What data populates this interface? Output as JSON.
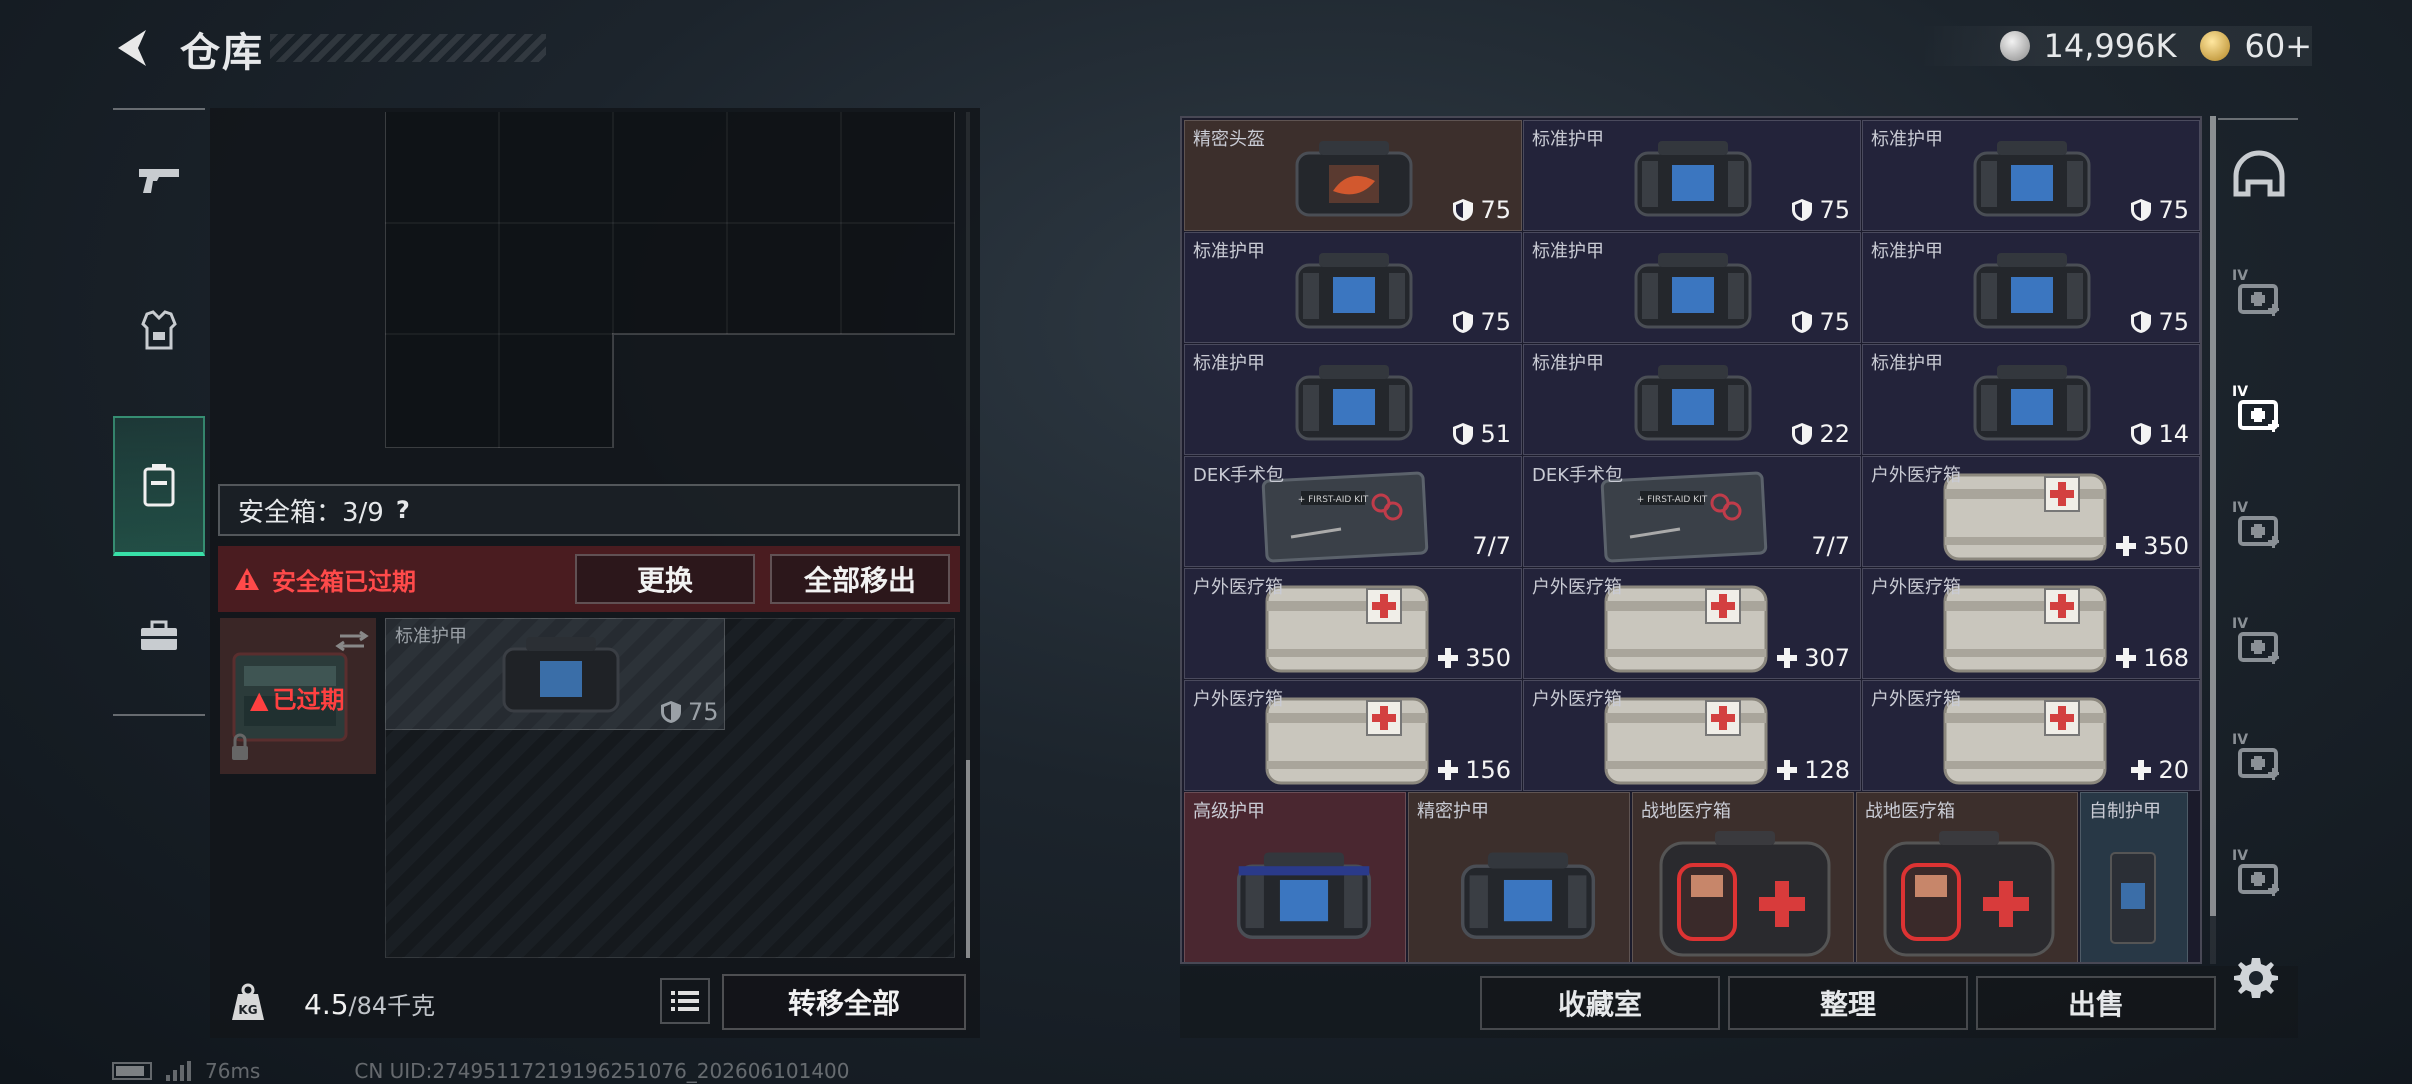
{
  "header": {
    "title": "仓库"
  },
  "currency": {
    "silver": "14,996K",
    "gold": "60+"
  },
  "side_nav": [
    {
      "icon": "pistol-icon"
    },
    {
      "icon": "vest-icon"
    },
    {
      "icon": "safe-case-icon",
      "active": true
    },
    {
      "icon": "toolbox-icon"
    }
  ],
  "safe_case": {
    "label": "安全箱：3/9",
    "help": "?",
    "warning": "安全箱已过期",
    "replace_label": "更换",
    "move_out_label": "全部移出",
    "expired_badge": "已过期",
    "item": {
      "name": "标准护甲",
      "value": "75"
    }
  },
  "weight": {
    "current": "4.5",
    "max_text": "/84千克",
    "unit_icon": "KG"
  },
  "transfer_all_label": "转移全部",
  "stash_items": [
    {
      "name": "精密头盔",
      "value": "75",
      "kind": "shield",
      "bg": "brown",
      "art": "helmet"
    },
    {
      "name": "标准护甲",
      "value": "75",
      "kind": "shield",
      "art": "armor"
    },
    {
      "name": "标准护甲",
      "value": "75",
      "kind": "shield",
      "art": "armor"
    },
    {
      "name": "标准护甲",
      "value": "75",
      "kind": "shield",
      "art": "armor"
    },
    {
      "name": "标准护甲",
      "value": "75",
      "kind": "shield",
      "art": "armor"
    },
    {
      "name": "标准护甲",
      "value": "75",
      "kind": "shield",
      "art": "armor"
    },
    {
      "name": "标准护甲",
      "value": "51",
      "kind": "shield",
      "art": "armor"
    },
    {
      "name": "标准护甲",
      "value": "22",
      "kind": "shield",
      "art": "armor"
    },
    {
      "name": "标准护甲",
      "value": "14",
      "kind": "shield",
      "art": "armor"
    },
    {
      "name": "DEK手术包",
      "value": "7/7",
      "kind": "plain",
      "art": "surgery"
    },
    {
      "name": "DEK手术包",
      "value": "7/7",
      "kind": "plain",
      "art": "surgery"
    },
    {
      "name": "户外医疗箱",
      "value": "350",
      "kind": "plus",
      "art": "medkit"
    },
    {
      "name": "户外医疗箱",
      "value": "350",
      "kind": "plus",
      "art": "medkit"
    },
    {
      "name": "户外医疗箱",
      "value": "307",
      "kind": "plus",
      "art": "medkit"
    },
    {
      "name": "户外医疗箱",
      "value": "168",
      "kind": "plus",
      "art": "medkit"
    },
    {
      "name": "户外医疗箱",
      "value": "156",
      "kind": "plus",
      "art": "medkit"
    },
    {
      "name": "户外医疗箱",
      "value": "128",
      "kind": "plus",
      "art": "medkit"
    },
    {
      "name": "户外医疗箱",
      "value": "20",
      "kind": "plus",
      "art": "medkit"
    }
  ],
  "stash_bottom_items": [
    {
      "name": "高级护甲",
      "bg": "red",
      "art": "armor-adv"
    },
    {
      "name": "精密护甲",
      "bg": "brown",
      "art": "armor"
    },
    {
      "name": "战地医疗箱",
      "bg": "brown",
      "art": "firstaid"
    },
    {
      "name": "战地医疗箱",
      "bg": "brown",
      "art": "firstaid"
    },
    {
      "name": "自制护甲",
      "bg": "blue",
      "art": "homemade"
    }
  ],
  "categories": [
    {
      "icon": "helmet-category-icon"
    },
    {
      "icon": "stash-tab-iv-1-icon",
      "label": "IV"
    },
    {
      "icon": "stash-tab-iv-2-icon",
      "label": "IV"
    },
    {
      "icon": "stash-tab-iv-3-icon",
      "label": "IV"
    },
    {
      "icon": "stash-tab-iv-4-icon",
      "label": "IV"
    },
    {
      "icon": "stash-tab-iv-5-icon",
      "label": "IV"
    },
    {
      "icon": "stash-tab-iv-6-icon",
      "label": "IV"
    }
  ],
  "bottom_buttons": {
    "collection": "收藏室",
    "sort": "整理",
    "sell": "出售"
  },
  "footer": {
    "ping": "76ms",
    "uid": "CN UID:2749511721919625107​6_202606101400"
  },
  "colors": {
    "accent": "#38e0a8",
    "warning": "#ff4a4a",
    "shield": "#ffffff"
  }
}
